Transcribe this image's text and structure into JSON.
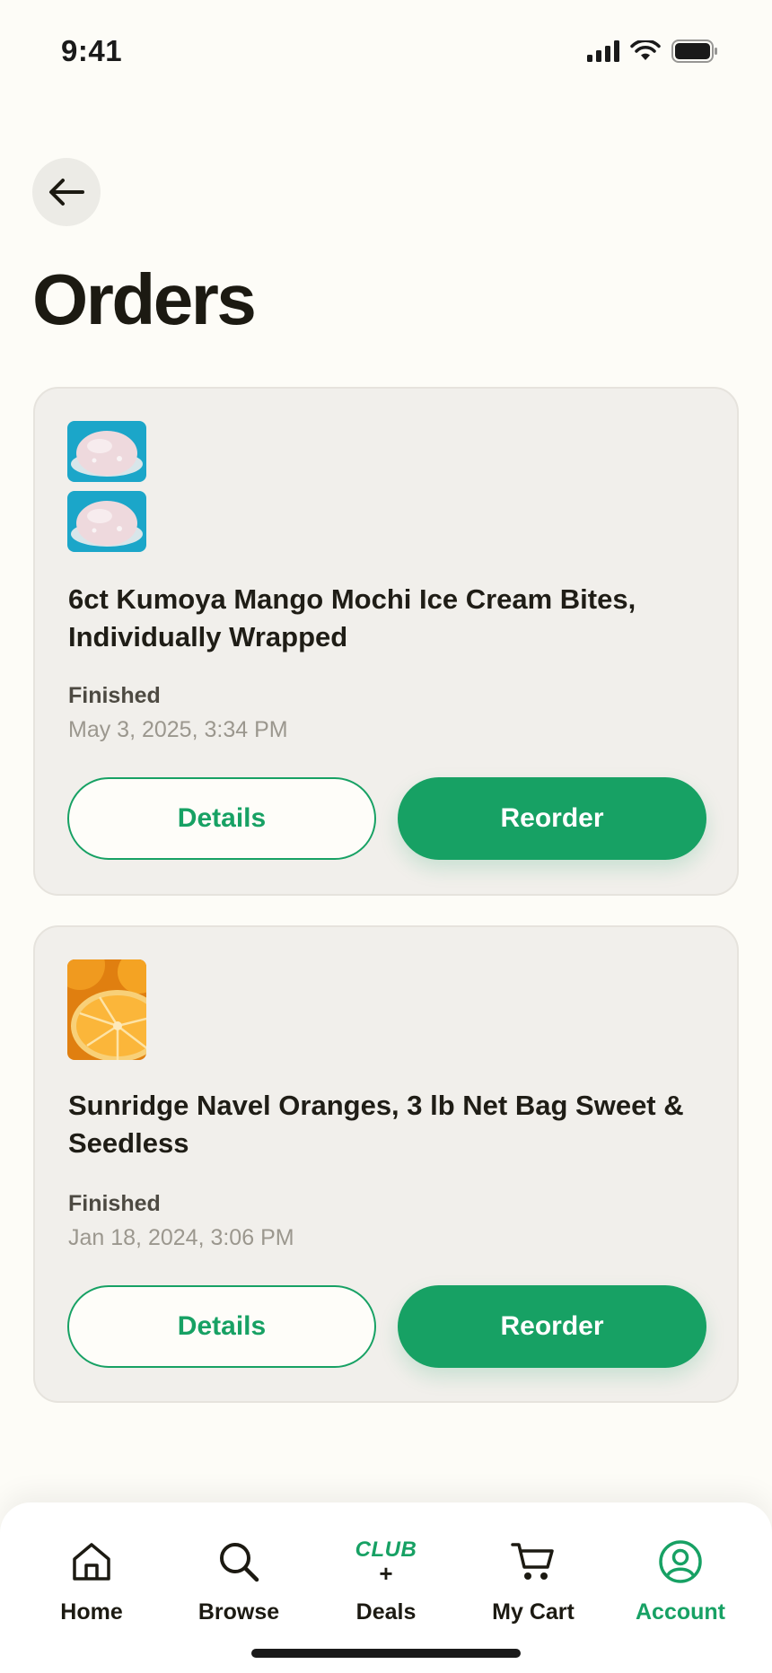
{
  "status_bar": {
    "time": "9:41"
  },
  "header": {
    "back_icon": "arrow-left-icon",
    "title": "Orders"
  },
  "orders": [
    {
      "title": "6ct Kumoya Mango Mochi Ice Cream Bites, Individually Wrapped",
      "status": "Finished",
      "date": "May 3, 2025, 3:34 PM",
      "details_label": "Details",
      "reorder_label": "Reorder"
    },
    {
      "title": "Sunridge Navel Oranges, 3 lb Net Bag Sweet & Seedless",
      "status": "Finished",
      "date": "Jan 18, 2024, 3:06 PM",
      "details_label": "Details",
      "reorder_label": "Reorder"
    }
  ],
  "tab_bar": {
    "home": "Home",
    "browse": "Browse",
    "deals_club": "CLUB",
    "deals_plus": "+",
    "deals": "Deals",
    "cart": "My Cart",
    "account": "Account",
    "active": "Account"
  },
  "colors": {
    "accent": "#17a164",
    "background": "#fdfcf7",
    "card": "#f1efeb"
  }
}
